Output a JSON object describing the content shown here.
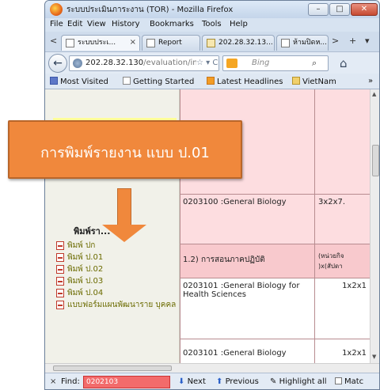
{
  "window": {
    "title": "ระบบประเมินภาระงาน (TOR) - Mozilla Firefox",
    "min_label": "–",
    "max_label": "□",
    "close_label": "✕"
  },
  "menu": [
    "File",
    "Edit",
    "View",
    "History",
    "Bookmarks",
    "Tools",
    "Help"
  ],
  "tabs": {
    "scroll_left": "<",
    "items": [
      {
        "label": "ระบบประเ...",
        "close": "×"
      },
      {
        "label": "Report"
      },
      {
        "label": "202.28.32.13..."
      },
      {
        "label": "ห้ามปิดห..."
      }
    ],
    "scroll_right": ">",
    "new_tab": "+",
    "list": "▾"
  },
  "nav": {
    "back": "←",
    "url_host": "202.28.32.130",
    "url_path": "/evaluation/inde",
    "url_icons": "☆ ▾ C",
    "search_placeholder": "Bing",
    "search_glyph": "⌕",
    "home": "⌂"
  },
  "bookmarks": [
    "Most Visited",
    "Getting Started",
    "Latest Headlines",
    "VietNam"
  ],
  "bookmarks_more": "»",
  "left": {
    "heading": "พิมพ์รา...",
    "items": [
      "พิมพ์ ปก",
      "พิมพ์ ป.01",
      "พิมพ์ ป.02",
      "พิมพ์ ป.03",
      "พิมพ์ ป.04",
      "แบบฟอร์มแผนพัฒนาราย บุคคล"
    ]
  },
  "table": {
    "rows": [
      {
        "course": "0203100 :General Biology",
        "value": "3x2x7."
      },
      {
        "course": "1.2) การสอนภาคปฏิบัติ",
        "value": "(หน่วยกิจ\n)x(สัปดา"
      },
      {
        "course": "0203101 :General Biology for Health Sciences",
        "value": "1x2x1"
      },
      {
        "course": "0203101 :General Biology",
        "value": "1x2x1"
      }
    ]
  },
  "findbar": {
    "close": "×",
    "label": "Find:",
    "value": "0202103",
    "next": "Next",
    "previous": "Previous",
    "highlight": "Highlight all",
    "match": "Matc"
  },
  "callout": {
    "text": "การพิมพ์รายงาน แบบ ป.01"
  },
  "colors": {
    "accent": "#f0883c",
    "find_error": "#f26b6b",
    "row_pink": "#fddde0"
  }
}
